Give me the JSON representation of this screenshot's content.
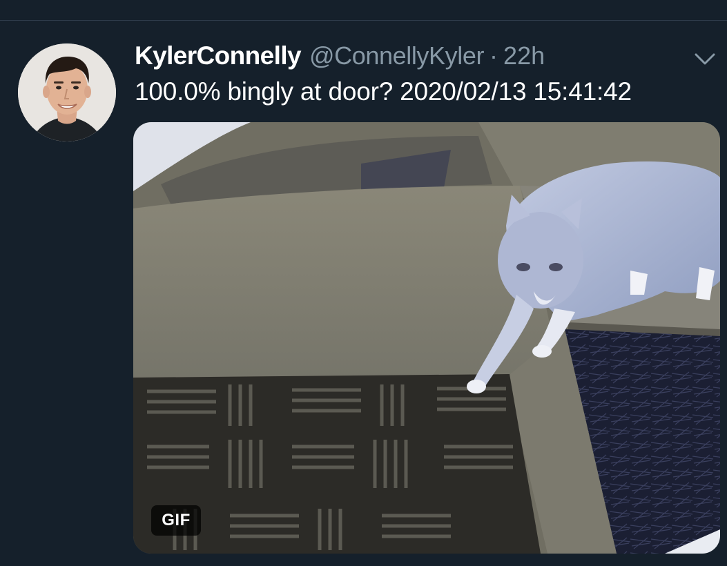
{
  "tweet": {
    "display_name": "KylerConnelly",
    "handle": "@ConnellyKyler",
    "separator": "·",
    "time": "22h",
    "text": "100.0% bingly at door? 2020/02/13 15:41:42",
    "menu_icon": "chevron-down-icon",
    "avatar_icon": "avatar"
  },
  "media": {
    "type": "gif",
    "badge_label": "GIF"
  },
  "colors": {
    "background": "#15202b",
    "primary_text": "#ffffff",
    "secondary_text": "#8899a6",
    "divider": "#2f3d4c"
  }
}
